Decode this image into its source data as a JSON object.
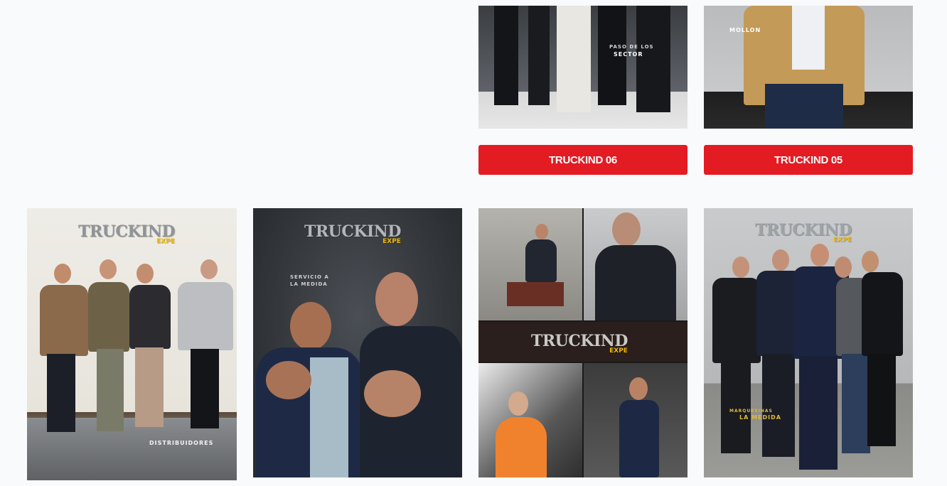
{
  "buttons": {
    "truckind06": "TRUCKIND 06",
    "truckind05": "TRUCKIND 05"
  },
  "covers": {
    "top_left_caption_1": "PASO DE LOS",
    "top_left_caption_2": "SECTOR",
    "top_right_caption": "MOLLON",
    "logo": "TRUCKIND",
    "logo_sub": "EXPE",
    "cover1_caption": "DISTRIBUIDORES",
    "cover2_caption": "SERVICIO A LA MEDIDA",
    "cover4_caption_1": "MARQUESINAS",
    "cover4_caption_2": "LA MEDIDA"
  },
  "colors": {
    "button_red": "#e31b23",
    "page_bg": "#f9fafb"
  }
}
